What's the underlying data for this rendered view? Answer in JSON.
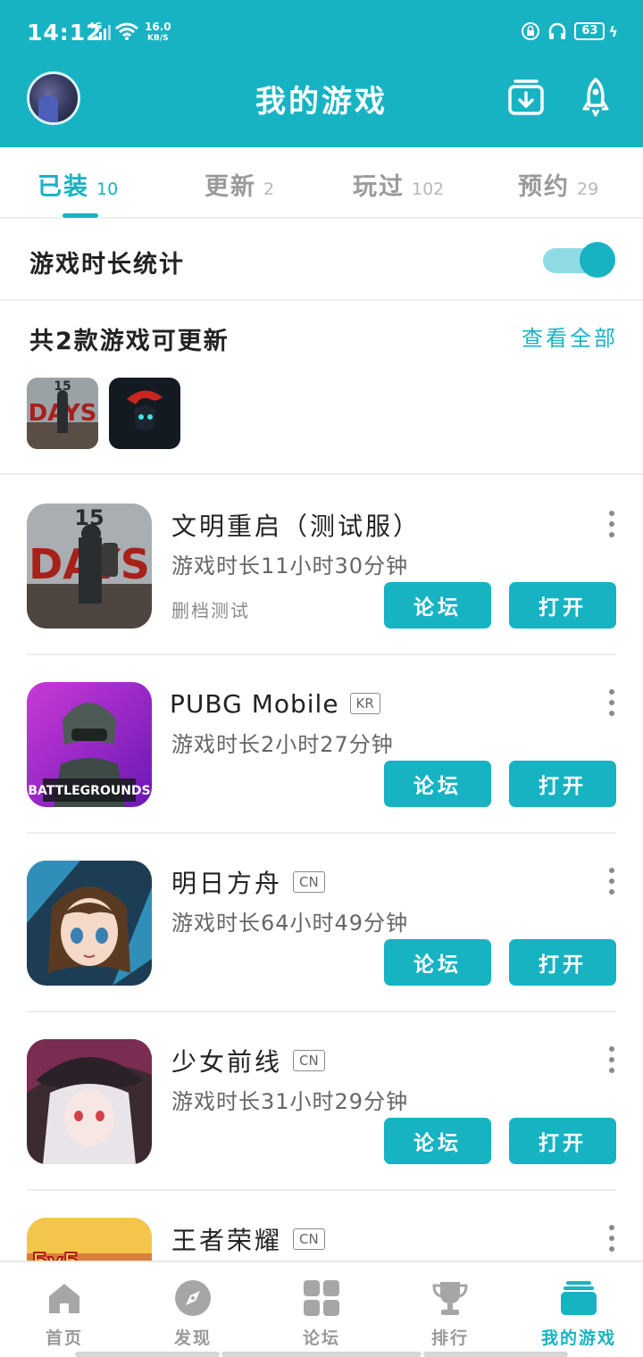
{
  "status_bar": {
    "time": "14:12",
    "network": "4G",
    "speed_value": "16.0",
    "speed_unit": "KB/S",
    "battery": "63"
  },
  "header": {
    "title": "我的游戏"
  },
  "tabs": [
    {
      "label": "已装",
      "count": "10",
      "active": true
    },
    {
      "label": "更新",
      "count": "2",
      "active": false
    },
    {
      "label": "玩过",
      "count": "102",
      "active": false
    },
    {
      "label": "预约",
      "count": "29",
      "active": false
    }
  ],
  "stats": {
    "label": "游戏时长统计",
    "enabled": true
  },
  "updates": {
    "title": "共2款游戏可更新",
    "view_all": "查看全部"
  },
  "games": [
    {
      "name": "文明重启（测试服）",
      "badge": "",
      "playtime": "游戏时长11小时30分钟",
      "note": "删档测试",
      "forum": "论坛",
      "open": "打开",
      "icon": "15-days-icon"
    },
    {
      "name": "PUBG Mobile",
      "badge": "KR",
      "playtime": "游戏时长2小时27分钟",
      "note": "",
      "forum": "论坛",
      "open": "打开",
      "icon": "pubg-icon"
    },
    {
      "name": "明日方舟",
      "badge": "CN",
      "playtime": "游戏时长64小时49分钟",
      "note": "",
      "forum": "论坛",
      "open": "打开",
      "icon": "arknights-icon"
    },
    {
      "name": "少女前线",
      "badge": "CN",
      "playtime": "游戏时长31小时29分钟",
      "note": "",
      "forum": "论坛",
      "open": "打开",
      "icon": "girls-frontline-icon"
    },
    {
      "name": "王者荣耀",
      "badge": "CN",
      "playtime": "",
      "note": "",
      "forum": "",
      "open": "",
      "icon": "honor-of-kings-icon"
    }
  ],
  "bottom_nav": [
    {
      "label": "首页",
      "icon": "home-icon",
      "active": false
    },
    {
      "label": "发现",
      "icon": "compass-icon",
      "active": false
    },
    {
      "label": "论坛",
      "icon": "grid-icon",
      "active": false
    },
    {
      "label": "排行",
      "icon": "trophy-icon",
      "active": false
    },
    {
      "label": "我的游戏",
      "icon": "my-games-icon",
      "active": true
    }
  ],
  "colors": {
    "accent": "#17b3c3",
    "toggle_track": "#8fdbe4",
    "inactive_text": "#9a9a9a"
  }
}
